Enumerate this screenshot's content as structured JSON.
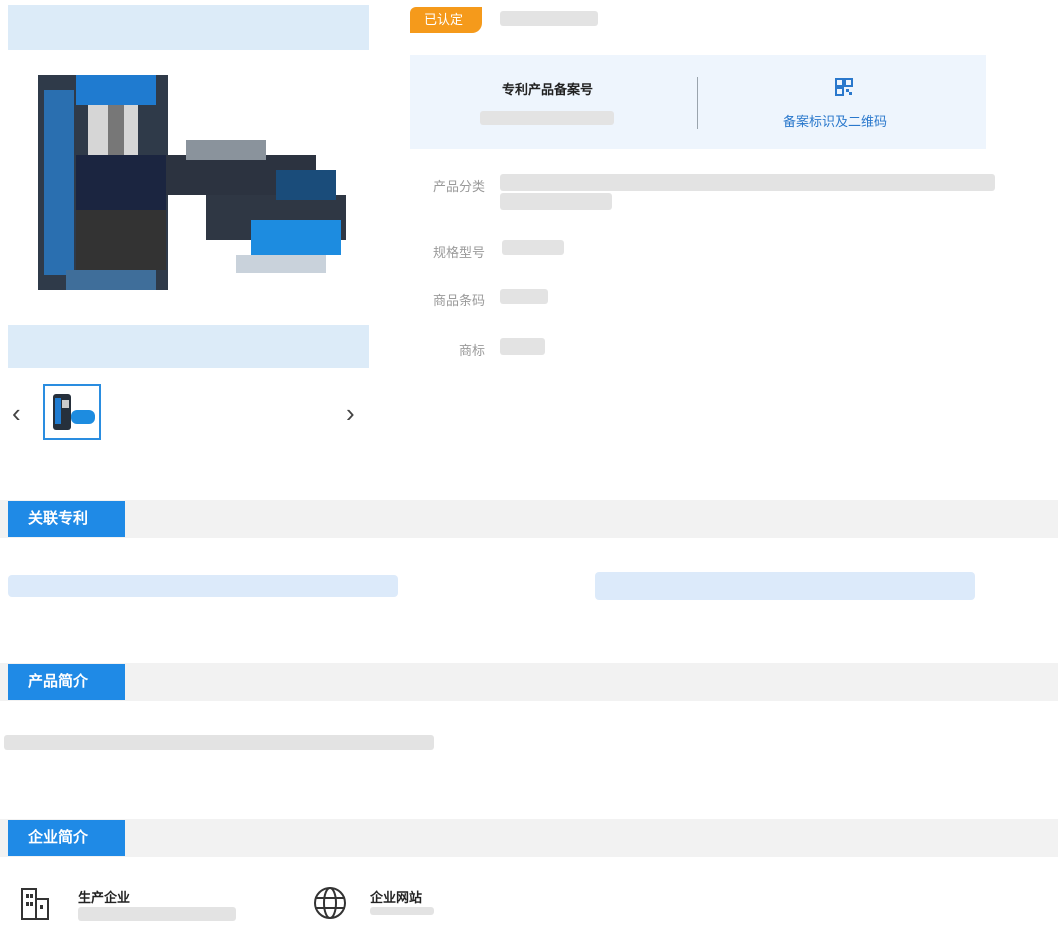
{
  "badge": "已认定",
  "record": {
    "title": "专利产品备案号",
    "qr_link": "备案标识及二维码",
    "qr_icon": "qr-code-icon"
  },
  "fields": {
    "category_label": "产品分类",
    "model_label": "规格型号",
    "barcode_label": "商品条码",
    "brand_label": "商标"
  },
  "nav": {
    "prev": "‹",
    "next": "›"
  },
  "sections": {
    "related_patents": "关联专利",
    "product_intro": "产品简介",
    "company_intro": "企业简介"
  },
  "company": {
    "manufacturer_label": "生产企业",
    "website_label": "企业网站",
    "building_icon": "building-icon",
    "globe_icon": "globe-icon"
  },
  "colors": {
    "accent": "#1f8ae6",
    "badge": "#f59a1b",
    "record_bg": "#eef5fd",
    "link": "#2a78cc"
  }
}
